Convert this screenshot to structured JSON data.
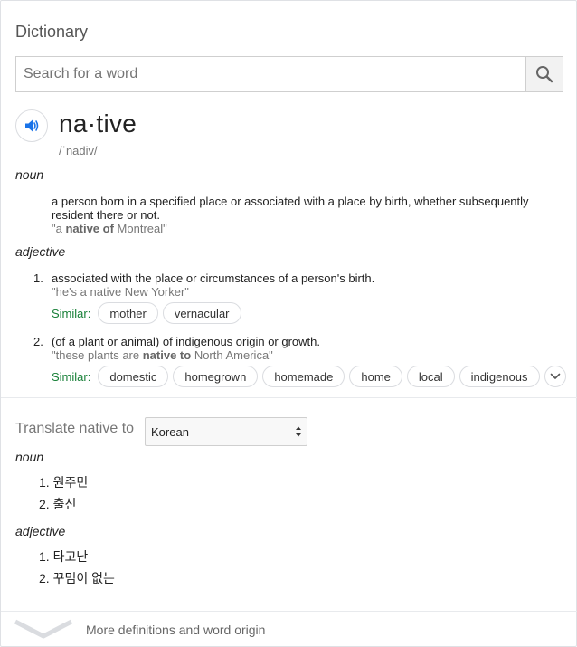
{
  "title": "Dictionary",
  "search": {
    "placeholder": "Search for a word",
    "value": ""
  },
  "entry": {
    "headword": "na·tive",
    "phonetic": "/ˈnādiv/"
  },
  "noun": {
    "pos": "noun",
    "definition_line1": "a person born in a specified place or associated with a place by birth, whether subsequently",
    "definition_line2": "resident there or not.",
    "example_pre": "\"a ",
    "example_bold": "native of",
    "example_post": " Montreal\""
  },
  "adjective": {
    "pos": "adjective",
    "senses": [
      {
        "num": "1.",
        "definition": "associated with the place or circumstances of a person's birth.",
        "example": "\"he's a native New Yorker\"",
        "similar_label": "Similar:",
        "similar": [
          "mother",
          "vernacular"
        ]
      },
      {
        "num": "2.",
        "definition": "(of a plant or animal) of indigenous origin or growth.",
        "example_pre": "\"these plants are ",
        "example_bold": "native to",
        "example_post": " North America\"",
        "similar_label": "Similar:",
        "similar": [
          "domestic",
          "homegrown",
          "homemade",
          "home",
          "local",
          "indigenous"
        ]
      }
    ]
  },
  "translate": {
    "label": "Translate native to",
    "language": "Korean",
    "noun_pos": "noun",
    "noun_items": [
      "1. 원주민",
      "2. 출신"
    ],
    "adj_pos": "adjective",
    "adj_items": [
      "1. 타고난",
      "2. 꾸밈이 없는"
    ]
  },
  "footer": {
    "more_text": "More definitions and word origin"
  },
  "colors": {
    "similar_label": "#188038",
    "speaker_accent": "#1a73e8"
  },
  "icons": {
    "search": "search-icon",
    "speaker": "speaker-icon",
    "expand": "chevron-down-icon"
  }
}
